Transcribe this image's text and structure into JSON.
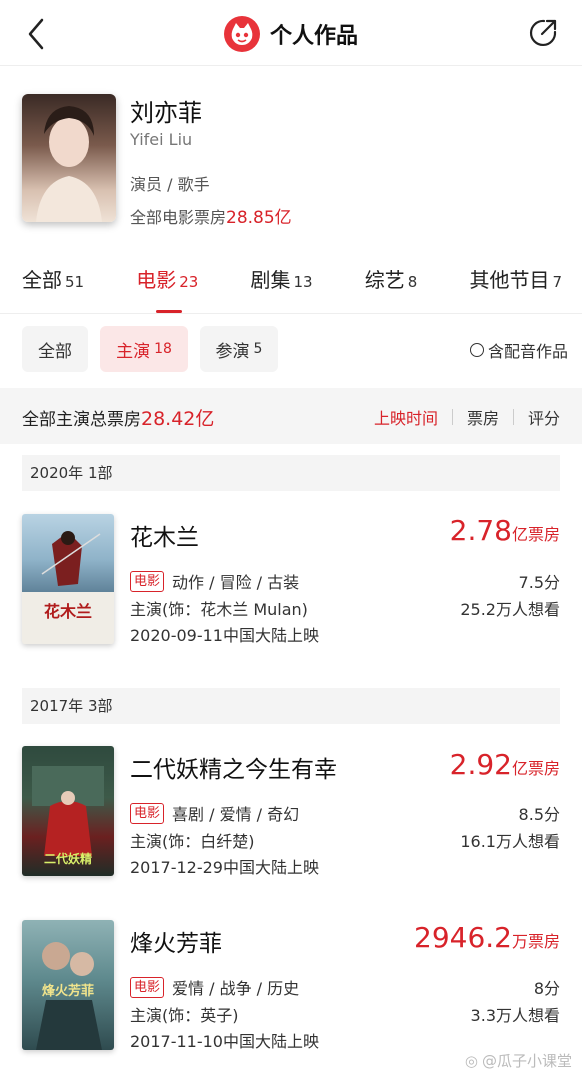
{
  "header": {
    "title": "个人作品"
  },
  "profile": {
    "name_cn": "刘亦菲",
    "name_en": "Yifei Liu",
    "roles": "演员 / 歌手",
    "box_label": "全部电影票房",
    "box_value": "28.85亿"
  },
  "tabs": [
    {
      "label": "全部",
      "count": "51"
    },
    {
      "label": "电影",
      "count": "23"
    },
    {
      "label": "剧集",
      "count": "13"
    },
    {
      "label": "综艺",
      "count": "8"
    },
    {
      "label": "其他节目",
      "count": "7"
    }
  ],
  "filters": [
    {
      "label": "全部",
      "count": ""
    },
    {
      "label": "主演",
      "count": "18"
    },
    {
      "label": "参演",
      "count": "5"
    }
  ],
  "dub_label": "含配音作品",
  "summary": {
    "label": "全部主演总票房",
    "value": "28.42亿"
  },
  "sorts": [
    "上映时间",
    "票房",
    "评分"
  ],
  "years": [
    {
      "label": "2020年  1部"
    },
    {
      "label": "2017年  3部"
    }
  ],
  "movies": [
    {
      "title": "花木兰",
      "box_num": "2.78",
      "box_unit": "亿票房",
      "tag": "电影",
      "genres": "动作 / 冒险 / 古装",
      "score": "7.5分",
      "role": "主演(饰：花木兰 Mulan)",
      "want": "25.2万人想看",
      "date": "2020-09-11中国大陆上映",
      "poster_text": "花木兰"
    },
    {
      "title": "二代妖精之今生有幸",
      "box_num": "2.92",
      "box_unit": "亿票房",
      "tag": "电影",
      "genres": "喜剧 / 爱情 / 奇幻",
      "score": "8.5分",
      "role": "主演(饰：白纤楚)",
      "want": "16.1万人想看",
      "date": "2017-12-29中国大陆上映",
      "poster_text": "二代妖精"
    },
    {
      "title": "烽火芳菲",
      "box_num": "2946.2",
      "box_unit": "万票房",
      "tag": "电影",
      "genres": "爱情 / 战争 / 历史",
      "score": "8分",
      "role": "主演(饰：英子)",
      "want": "3.3万人想看",
      "date": "2017-11-10中国大陆上映",
      "poster_text": "烽火芳菲"
    }
  ],
  "watermark": "@瓜子小课堂"
}
